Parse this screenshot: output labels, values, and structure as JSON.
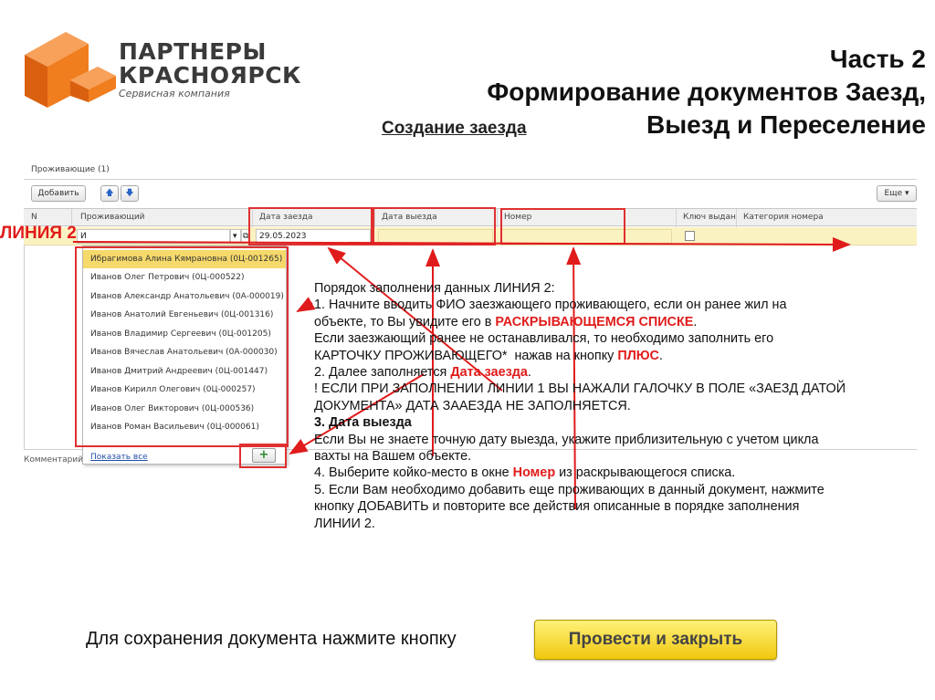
{
  "logo": {
    "line1": "ПАРТНЕРЫ",
    "line2": "КРАСНОЯРСК",
    "line3": "Сервисная компания",
    "color": "#f07d1e"
  },
  "header": {
    "title_line1": "Часть 2",
    "title_line2": "Формирование документов Заезд,",
    "title_line3": "Выезд и Переселение",
    "subtitle": "Создание заезда"
  },
  "form": {
    "tab_label": "Проживающие (1)",
    "add_button": "Добавить",
    "up_icon": "arrow-up-icon",
    "down_icon": "arrow-down-icon",
    "more_button": "Еще ▾",
    "columns": [
      "N",
      "Проживающий",
      "Дата заезда",
      "Дата выезда",
      "Номер",
      "Ключ выдан",
      "Категория номера"
    ],
    "row": {
      "resident_value": "И",
      "arrival_date": "29.05.2023",
      "departure_date": "",
      "room": "",
      "key_issued": false,
      "room_category": ""
    },
    "comment_label": "Комментарий"
  },
  "dropdown": {
    "items": [
      "Ибрагимова Алина Кямрановна (0Ц-001265)",
      "Иванов Олег Петрович (0Ц-000522)",
      "Иванов Александр Анатольевич (0А-000019)",
      "Иванов Анатолий Евгеньевич (0Ц-001316)",
      "Иванов Владимир Сергеевич (0Ц-001205)",
      "Иванов Вячеслав Анатольевич (0А-000030)",
      "Иванов Дмитрий Андреевич (0Ц-001447)",
      "Иванов Кирилл Олегович (0Ц-000257)",
      "Иванов Олег Викторович (0Ц-000536)",
      "Иванов Роман Васильевич (0Ц-000061)"
    ],
    "selected_index": 0,
    "show_all": "Показать все",
    "plus_button": "+"
  },
  "annotation": {
    "liniya2": "ЛИНИЯ 2"
  },
  "instructions": {
    "l1": "Порядок заполнения данных ЛИНИЯ 2:",
    "l2": "1. Начните вводить ФИО заезжающего проживающего, если он ранее жил на",
    "l3a": "объекте, то Вы увидите его в ",
    "l3b": "РАСКРЫВАЮЩЕМСЯ СПИСКЕ",
    "l3c": ".",
    "l4": "Если заезжающий ранее не останавливался, то необходимо заполнить его",
    "l5a": "КАРТОЧКУ ПРОЖИВАЮЩЕГО*  нажав на кнопку ",
    "l5b": "ПЛЮС",
    "l5c": ".",
    "l6a": "2. Далее заполняется ",
    "l6b": "Дата заезда",
    "l6c": ".",
    "l7": "! ЕСЛИ ПРИ ЗАПОЛНЕНИИ ЛИНИИ 1 ВЫ НАЖАЛИ ГАЛОЧКУ В ПОЛЕ «ЗАЕЗД ДАТОЙ",
    "l8": "ДОКУМЕНТА» ДАТА ЗААЕЗДА НЕ ЗАПОЛНЯЕТСЯ.",
    "l9": "3. Дата выезда",
    "l10": "Если Вы не знаете точную дату выезда, укажите приблизительную с учетом цикла",
    "l11": "вахты на Вашем объекте.",
    "l12a": "4. Выберите койко-место в окне ",
    "l12b": "Номер",
    "l12c": " из раскрывающегося списка.",
    "l13": "5. Если Вам необходимо добавить еще проживающих в данный документ, нажмите",
    "l14": "кнопку ДОБАВИТЬ и повторите все действия описанные в порядке заполнения",
    "l15": "ЛИНИИ 2."
  },
  "footer": {
    "save_text": "Для сохранения документа нажмите кнопку",
    "save_button": "Провести и закрыть"
  },
  "colors": {
    "accent_red": "#e01b1b",
    "row_highlight": "#fbf2c2",
    "save_button": "#f5d21a"
  }
}
